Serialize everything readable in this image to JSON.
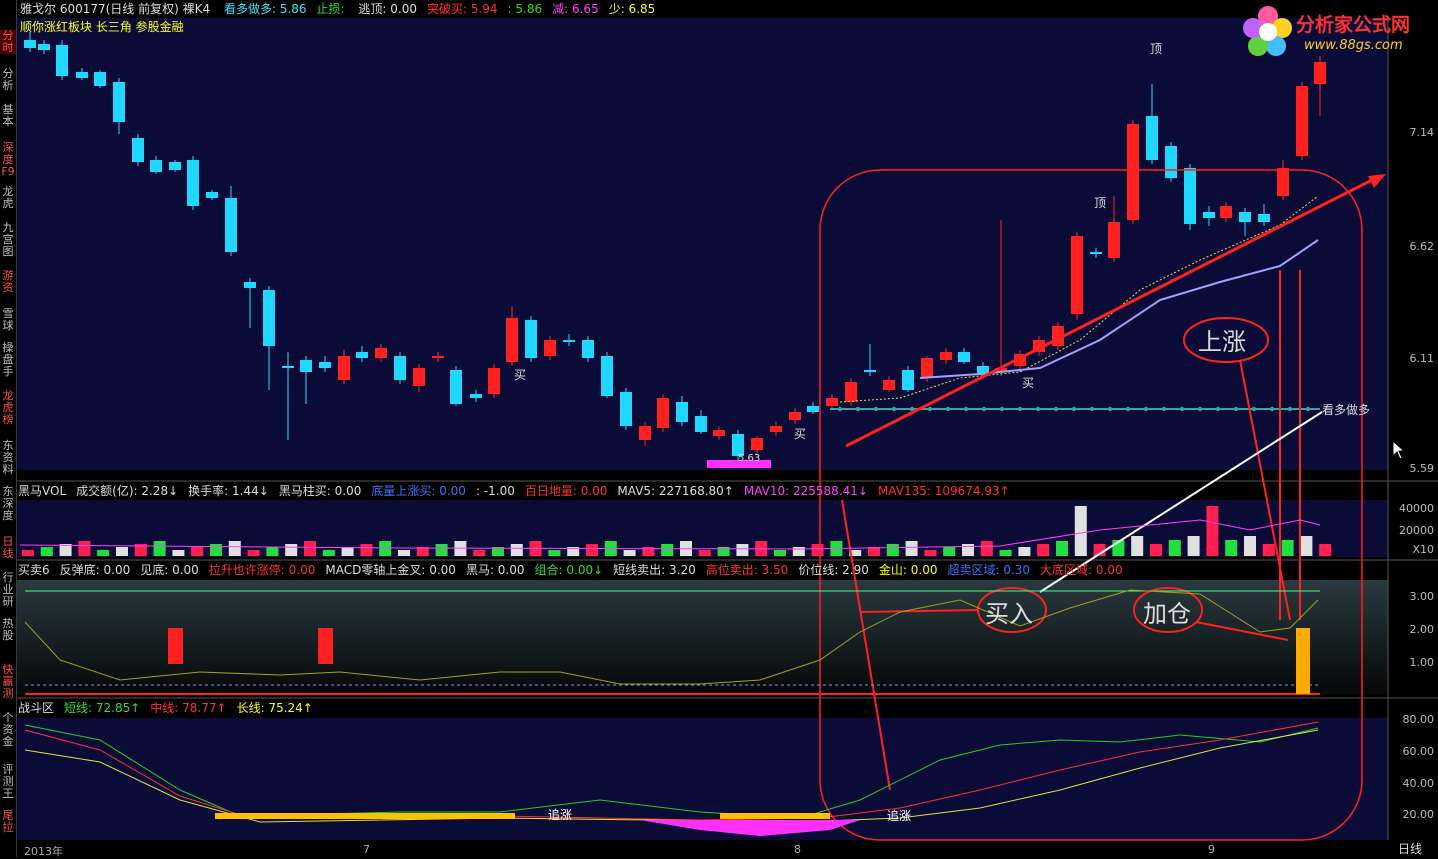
{
  "header": {
    "stock": "雅戈尔 600177(日线 前复权) 裸K4",
    "items": [
      {
        "text": "看多做多: 5.86",
        "color": "c"
      },
      {
        "text": "止损: ",
        "color": "g"
      },
      {
        "text": "逃顶: 0.00",
        "color": "w"
      },
      {
        "text": "突破买: 5.94",
        "color": "r"
      },
      {
        "text": ": 5.86",
        "color": "g"
      },
      {
        "text": "减: 6.65",
        "color": "m"
      },
      {
        "text": "少: 6.85",
        "color": "y"
      }
    ],
    "subtitle": "顺你涨红板块 长三角 参股金融"
  },
  "sidebar": {
    "items": [
      {
        "label": "分时",
        "active": true
      },
      {
        "label": "分析",
        "active": false
      },
      {
        "label": "基本",
        "active": false
      },
      {
        "label": "深度F9",
        "active": false
      },
      {
        "label": "龙虎",
        "active": false
      },
      {
        "label": "九宫图",
        "active": false
      },
      {
        "label": "游资",
        "active": false
      },
      {
        "label": "雪球",
        "active": false
      },
      {
        "label": "操盘手",
        "active": false
      },
      {
        "label": "龙虎榜",
        "active": false
      },
      {
        "label": "东资料",
        "active": false
      },
      {
        "label": "东深度",
        "active": false
      },
      {
        "label": "日线",
        "active": false
      },
      {
        "label": "行业研",
        "active": false
      },
      {
        "label": "热股",
        "active": false
      },
      {
        "label": "快赢测",
        "active": false
      },
      {
        "label": "个资金",
        "active": false
      },
      {
        "label": "评测王",
        "active": false
      },
      {
        "label": "尾拉",
        "active": false
      }
    ]
  },
  "logo": {
    "name": "分析家公式网",
    "url": "www.88gs.com"
  },
  "price_axis": [
    "7.14",
    "6.62",
    "6.11",
    "5.59"
  ],
  "main_labels": {
    "top1": "顶",
    "top2": "顶",
    "buy1": "买",
    "buy2": "买",
    "buy3": "买",
    "buy4": "买",
    "low": "5.63",
    "look": "看多做多"
  },
  "vol_panel": {
    "items": [
      {
        "text": "黑马VOL",
        "color": "w"
      },
      {
        "text": "成交额(亿): 2.28↓",
        "color": "w"
      },
      {
        "text": "换手率: 1.44↓",
        "color": "w"
      },
      {
        "text": "黑马柱买: 0.00",
        "color": "w"
      },
      {
        "text": "底量上涨买: 0.00",
        "color": "b"
      },
      {
        "text": ": -1.00",
        "color": "w"
      },
      {
        "text": "百日地量: 0.00",
        "color": "r"
      },
      {
        "text": "MAV5: 227168.80↑",
        "color": "w"
      },
      {
        "text": "MAV10: 225588.41↓",
        "color": "m"
      },
      {
        "text": "MAV135: 109674.93↑",
        "color": "r"
      }
    ],
    "axis": [
      "40000",
      "20000",
      "X10"
    ]
  },
  "ind_panel": {
    "items": [
      {
        "text": "买卖6",
        "color": "w"
      },
      {
        "text": "反弹底: 0.00",
        "color": "w"
      },
      {
        "text": "见底: 0.00",
        "color": "w"
      },
      {
        "text": "拉升也许涨停: 0.00",
        "color": "r"
      },
      {
        "text": "MACD零轴上金叉: 0.00",
        "color": "w"
      },
      {
        "text": "黑马: 0.00",
        "color": "w"
      },
      {
        "text": "组合: 0.00↓",
        "color": "g"
      },
      {
        "text": "短线卖出: 3.20",
        "color": "w"
      },
      {
        "text": "高位卖出: 3.50",
        "color": "r"
      },
      {
        "text": "价位线: 2.90",
        "color": "w"
      },
      {
        "text": "金山: 0.00",
        "color": "y"
      },
      {
        "text": "超卖区域: 0.30",
        "color": "b"
      },
      {
        "text": "大底区域: 0.00",
        "color": "r"
      }
    ],
    "axis": [
      "3.00",
      "2.00",
      "1.00"
    ]
  },
  "fight_panel": {
    "items": [
      {
        "text": "战斗区",
        "color": "w"
      },
      {
        "text": "短线: 72.85↑",
        "color": "g"
      },
      {
        "text": "中线: 78.77↑",
        "color": "r"
      },
      {
        "text": "长线: 75.24↑",
        "color": "y"
      }
    ],
    "axis": [
      "80.00",
      "60.00",
      "40.00",
      "20.00"
    ],
    "labels": {
      "chase1": "追涨",
      "chase2": "追涨"
    }
  },
  "annotations": {
    "rise": "上涨",
    "buy": "买入",
    "add": "加仓"
  },
  "dates": {
    "year": "2013年",
    "d7": "7",
    "d8": "8",
    "d9": "9"
  },
  "corner": "日线",
  "colors": {
    "up": "#ff2020",
    "down": "#20d8ff",
    "bg": "#0a0a36"
  }
}
